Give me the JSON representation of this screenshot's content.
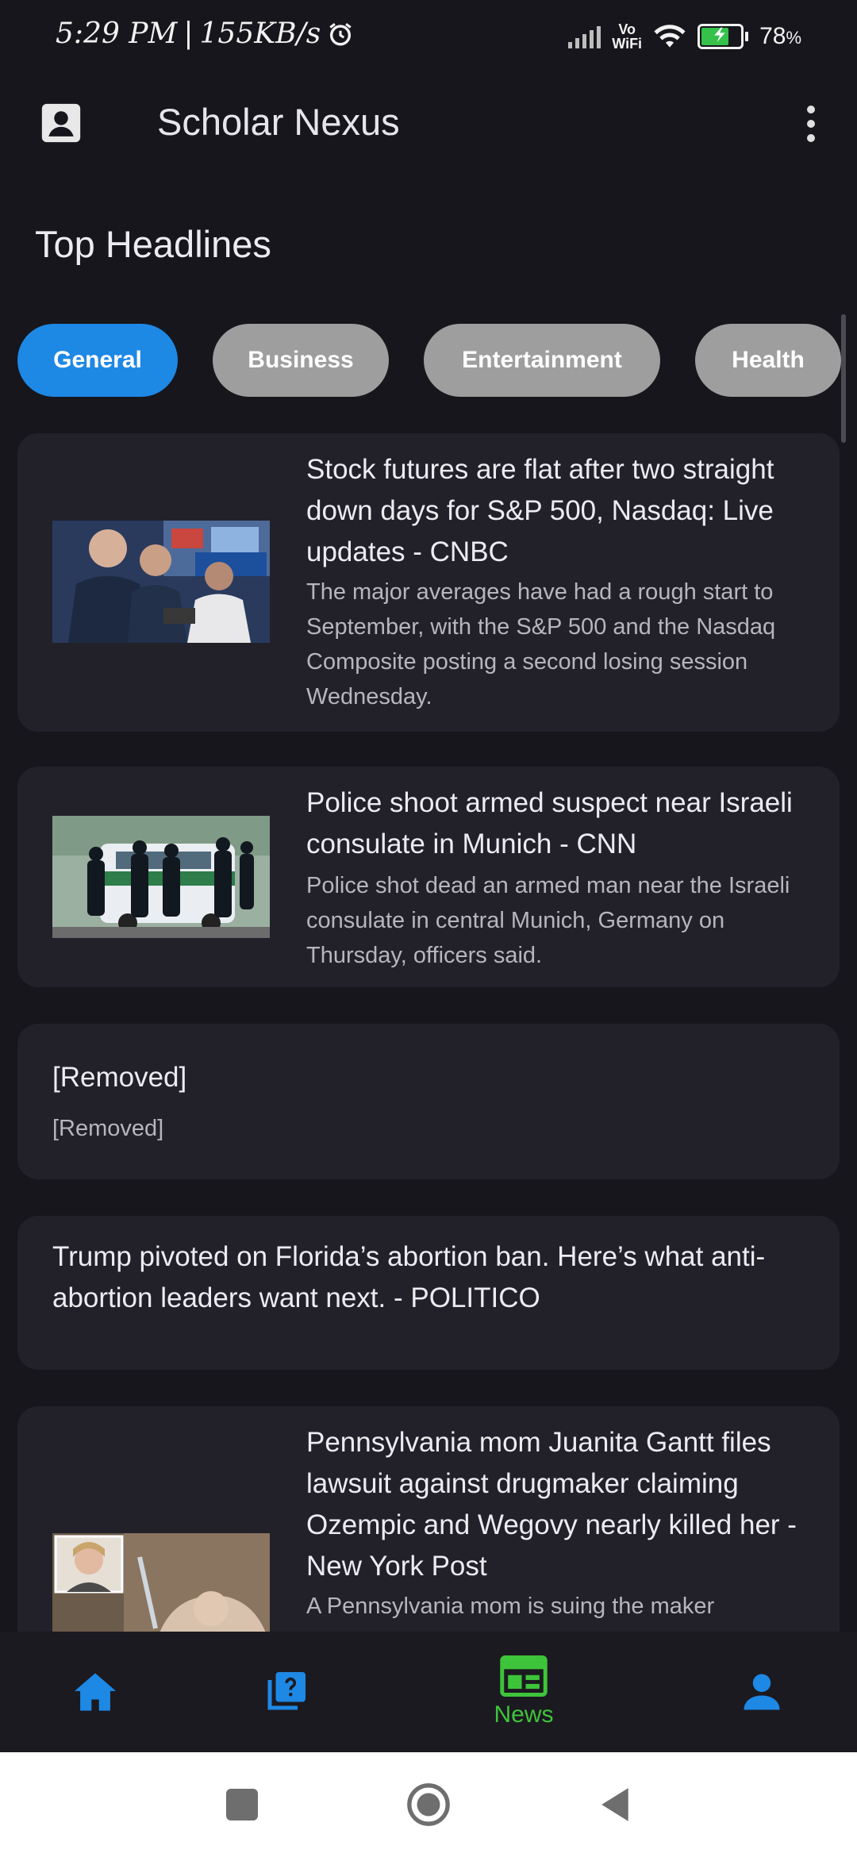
{
  "status_bar": {
    "time": "5:29 PM",
    "network_speed": "155KB/s",
    "battery_percent": "78",
    "battery_unit": "%",
    "battery_level": 0.78,
    "network_label": "Vo\nWiFi"
  },
  "app_bar": {
    "title": "Scholar Nexus",
    "account_icon": "account-box-icon",
    "menu_icon": "more-vert-icon"
  },
  "section_title": "Top Headlines",
  "categories": [
    {
      "label": "General",
      "active": true
    },
    {
      "label": "Business",
      "active": false
    },
    {
      "label": "Entertainment",
      "active": false
    },
    {
      "label": "Health",
      "active": false
    }
  ],
  "articles": [
    {
      "title": "Stock futures are flat after two straight down days for S&P 500, Nasdaq: Live updates - CNBC",
      "description": "The major averages have had a rough start to September, with the S&P 500 and the Nasdaq Composite posting a second losing session Wednesday.",
      "has_image": true
    },
    {
      "title": "Police shoot armed suspect near Israeli consulate in Munich - CNN",
      "description": "Police shot dead an armed man near the Israeli consulate in central Munich, Germany on Thursday, officers said.",
      "has_image": true
    },
    {
      "title": "[Removed]",
      "description": "[Removed]",
      "has_image": false
    },
    {
      "title": "Trump pivoted on Florida’s abortion ban. Here’s what anti-abortion leaders want next. - POLITICO",
      "description": "",
      "has_image": false
    },
    {
      "title": "Pennsylvania mom Juanita Gantt files lawsuit against drugmaker claiming Ozempic and Wegovy nearly killed her - New York Post",
      "description": "A Pennsylvania mom is suing the maker",
      "has_image": true
    }
  ],
  "bottom_nav": {
    "items": [
      {
        "icon": "home-icon",
        "label": ""
      },
      {
        "icon": "quiz-icon",
        "label": ""
      },
      {
        "icon": "newspaper-icon",
        "label": "News"
      },
      {
        "icon": "person-icon",
        "label": ""
      }
    ],
    "active_color": "#3ec43a",
    "inactive_color": "#1e88e5"
  },
  "system_nav": {
    "items": [
      "recents-square-icon",
      "home-circle-icon",
      "back-triangle-icon"
    ]
  }
}
